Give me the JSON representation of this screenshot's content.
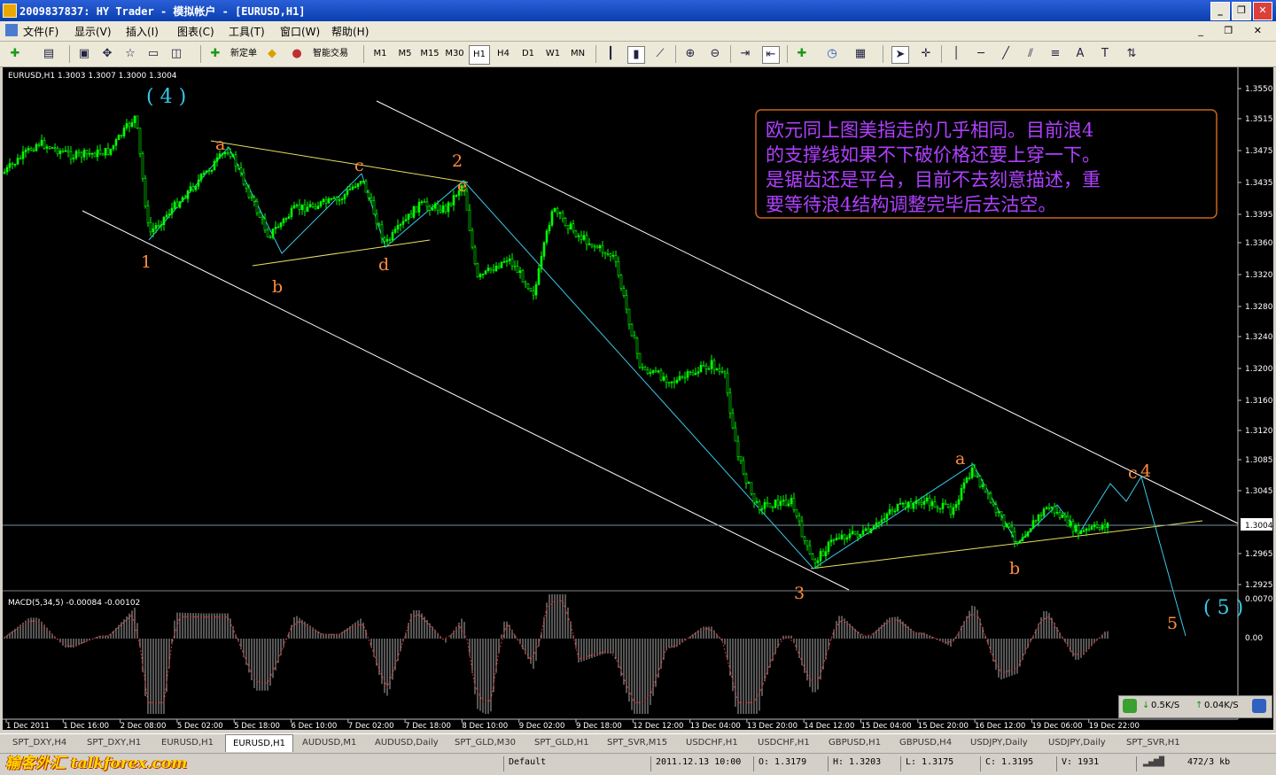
{
  "window": {
    "title": "2009837837: HY Trader - 模拟帐户 - [EURUSD,H1]",
    "buttons": [
      "_",
      "❐",
      "✕"
    ]
  },
  "menu": {
    "items": [
      "文件(F)",
      "显示(V)",
      "插入(I)",
      "图表(C)",
      "工具(T)",
      "窗口(W)",
      "帮助(H)"
    ],
    "mdi_buttons": "_ ❐ ✕"
  },
  "toolbar": {
    "new_order": "新定单",
    "expert_advisors": "智能交易",
    "timeframes": [
      "M1",
      "M5",
      "M15",
      "M30",
      "H1",
      "H4",
      "D1",
      "W1",
      "MN"
    ],
    "active_timeframe": "H1"
  },
  "chart": {
    "info": "EURUSD,H1  1.3003 1.3007 1.3000 1.3004",
    "macd_label": "MACD(5,34,5) -0.00084 -0.00102",
    "current_price": "1.3004",
    "annotation": [
      "欧元同上图美指走的几乎相同。目前浪4",
      "的支撑线如果不下破价格还要上穿一下。",
      "是锯齿还是平台，目前不去刻意描述，重",
      "要等待浪4结构调整完毕后去沽空。"
    ],
    "price_ticks": [
      "1.3550",
      "1.3515",
      "1.3475",
      "1.3435",
      "1.3395",
      "1.3360",
      "1.3320",
      "1.3280",
      "1.3240",
      "1.3200",
      "1.3160",
      "1.3120",
      "1.3085",
      "1.3045",
      "1.2965",
      "1.2925"
    ],
    "macd_ticks": [
      "0.00703",
      "0.00"
    ],
    "time_ticks": [
      "1 Dec 2011",
      "1 Dec 16:00",
      "2 Dec 08:00",
      "5 Dec 02:00",
      "5 Dec 18:00",
      "6 Dec 10:00",
      "7 Dec 02:00",
      "7 Dec 18:00",
      "8 Dec 10:00",
      "9 Dec 02:00",
      "9 Dec 18:00",
      "12 Dec 12:00",
      "13 Dec 04:00",
      "13 Dec 20:00",
      "14 Dec 12:00",
      "15 Dec 04:00",
      "15 Dec 20:00",
      "16 Dec 12:00",
      "19 Dec 06:00",
      "19 Dec 22:00"
    ],
    "wave_labels": [
      "( 4 )",
      "1",
      "a",
      "b",
      "c",
      "d",
      "2",
      "e",
      "3",
      "a",
      "b",
      "c",
      "4",
      "5",
      "( 5 )"
    ],
    "colors": {
      "candles": "#00ff00",
      "channel": "#ffffff",
      "triangle": "#e8e060",
      "wave": "#38c8e8",
      "macd_signal": "#e03030",
      "annotation_text": "#b040ff",
      "annotation_border": "#c86420",
      "wave_number": "#ff8c3c"
    }
  },
  "tabs": [
    "SPT_DXY,H4",
    "SPT_DXY,H1",
    "EURUSD,H1",
    "EURUSD,H1",
    "AUDUSD,M1",
    "AUDUSD,Daily",
    "SPT_GLD,M30",
    "SPT_GLD,H1",
    "SPT_SVR,M15",
    "USDCHF,H1",
    "USDCHF,H1",
    "GBPUSD,H1",
    "GBPUSD,H4",
    "USDJPY,Daily",
    "USDJPY,Daily",
    "SPT_SVR,H1"
  ],
  "active_tab": 3,
  "status": {
    "profile": "Default",
    "datetime": "2011.12.13 10:00",
    "open": "O: 1.3179",
    "high": "H: 1.3203",
    "low": "L: 1.3175",
    "close": "C: 1.3195",
    "volume": "V: 1931",
    "traffic": "472/3 kb"
  },
  "network": {
    "down": "0.5K/S",
    "up": "0.04K/S"
  },
  "watermark": "输客外汇 talkforex.com"
}
